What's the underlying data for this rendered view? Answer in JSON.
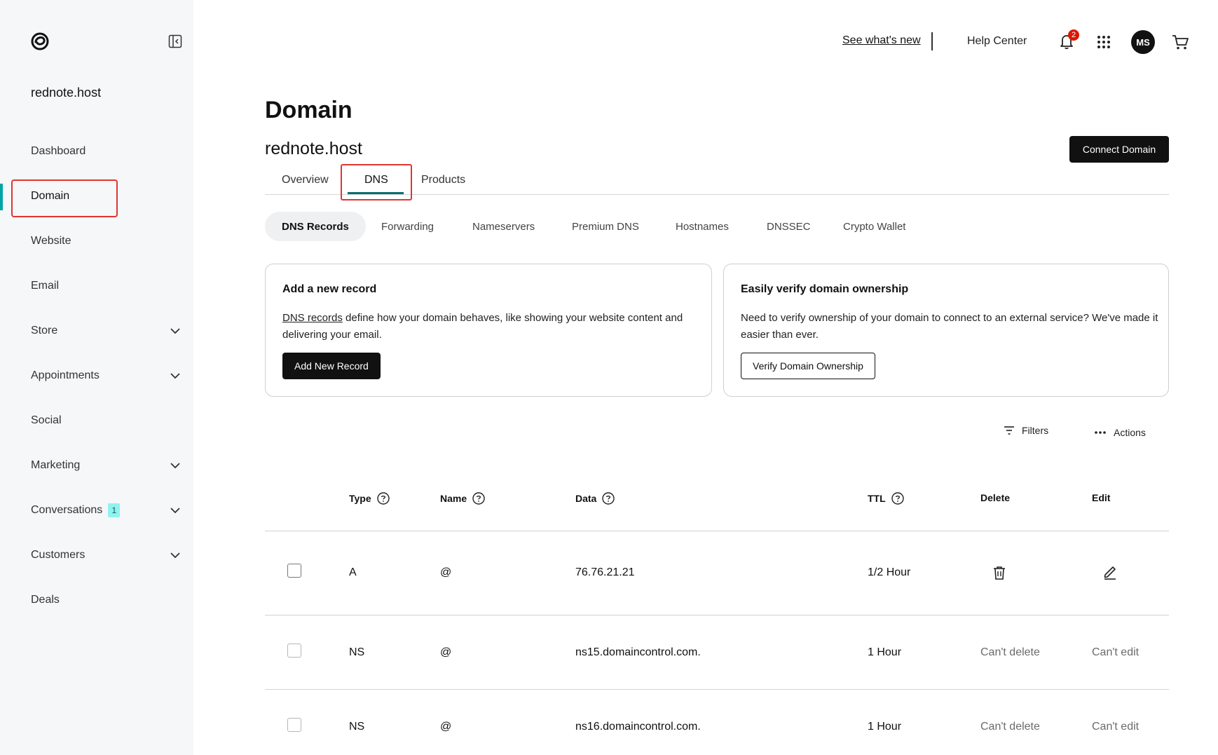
{
  "sidebar": {
    "site_name": "rednote.host",
    "items": [
      {
        "label": "Dashboard"
      },
      {
        "label": "Domain"
      },
      {
        "label": "Website"
      },
      {
        "label": "Email"
      },
      {
        "label": "Store"
      },
      {
        "label": "Appointments"
      },
      {
        "label": "Social"
      },
      {
        "label": "Marketing"
      },
      {
        "label": "Conversations",
        "badge": "1"
      },
      {
        "label": "Customers"
      },
      {
        "label": "Deals"
      }
    ]
  },
  "topbar": {
    "whats_new": "See what's new",
    "help": "Help Center",
    "notifications_count": "2",
    "avatar_initials": "MS"
  },
  "header": {
    "title": "Domain",
    "domain": "rednote.host",
    "connect_label": "Connect Domain"
  },
  "tabs": [
    {
      "label": "Overview"
    },
    {
      "label": "DNS"
    },
    {
      "label": "Products"
    }
  ],
  "subtabs": [
    {
      "label": "DNS Records"
    },
    {
      "label": "Forwarding"
    },
    {
      "label": "Nameservers"
    },
    {
      "label": "Premium DNS"
    },
    {
      "label": "Hostnames"
    },
    {
      "label": "DNSSEC"
    },
    {
      "label": "Crypto Wallet"
    }
  ],
  "cards": {
    "add": {
      "title": "Add a new record",
      "link_text": "DNS records",
      "text": " define how your domain behaves, like showing your website content and delivering your email.",
      "button": "Add New Record"
    },
    "verify": {
      "title": "Easily verify domain ownership",
      "text": "Need to verify ownership of your domain to connect to an external service? We've made it easier than ever.",
      "button": "Verify Domain Ownership"
    }
  },
  "toolbar": {
    "filters": "Filters",
    "actions": "Actions"
  },
  "table": {
    "headers": {
      "type": "Type",
      "name": "Name",
      "data": "Data",
      "ttl": "TTL",
      "delete": "Delete",
      "edit": "Edit"
    },
    "rows": [
      {
        "type": "A",
        "name": "@",
        "data": "76.76.21.21",
        "ttl": "1/2 Hour"
      },
      {
        "type": "NS",
        "name": "@",
        "data": "ns15.domaincontrol.com.",
        "ttl": "1 Hour",
        "delete": "Can't delete",
        "edit": "Can't edit"
      },
      {
        "type": "NS",
        "name": "@",
        "data": "ns16.domaincontrol.com.",
        "ttl": "1 Hour",
        "delete": "Can't delete",
        "edit": "Can't edit"
      }
    ]
  }
}
